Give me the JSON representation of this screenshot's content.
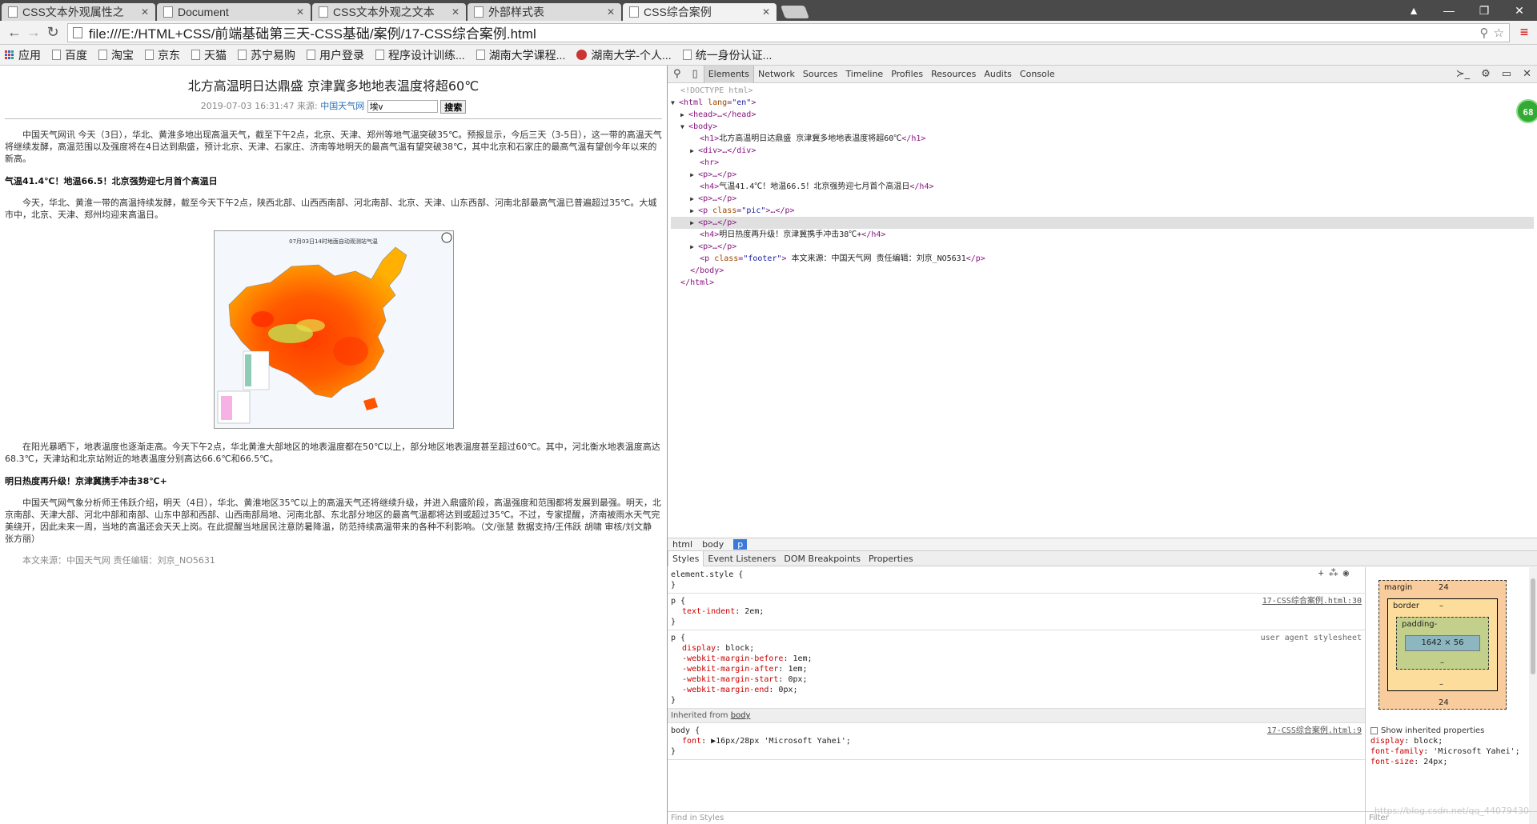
{
  "tabs": [
    {
      "title": "CSS文本外观属性之",
      "active": false
    },
    {
      "title": "Document",
      "active": false
    },
    {
      "title": "CSS文本外观之文本",
      "active": false
    },
    {
      "title": "外部样式表",
      "active": false
    },
    {
      "title": "CSS综合案例",
      "active": true
    }
  ],
  "address": {
    "url": "file:///E:/HTML+CSS/前端基础第三天-CSS基础/案例/17-CSS综合案例.html"
  },
  "bookmarks": [
    "应用",
    "百度",
    "淘宝",
    "京东",
    "天猫",
    "苏宁易购",
    "用户登录",
    "程序设计训练...",
    "湖南大学课程...",
    "湖南大学-个人...",
    "统一身份认证..."
  ],
  "article": {
    "title": "北方高温明日达鼎盛 京津冀多地地表温度将超60℃",
    "date_source": "2019-07-03 16:31:47 来源: ",
    "source_link": "中国天气网",
    "search_value": "埃v",
    "search_button": "搜索",
    "p1": "中国天气网讯 今天（3日），华北、黄淮多地出现高温天气，截至下午2点，北京、天津、郑州等地气温突破35℃。预报显示，今后三天（3-5日），这一带的高温天气将继续发酵，高温范围以及强度将在4日达到鼎盛，预计北京、天津、石家庄、济南等地明天的最高气温有望突破38℃，其中北京和石家庄的最高气温有望创今年以来的新高。",
    "h4_1": "气温41.4℃！地温66.5！北京强势迎七月首个高温日",
    "p2": "今天，华北、黄淮一带的高温持续发酵，截至今天下午2点，陕西北部、山西西南部、河北南部、北京、天津、山东西部、河南北部最高气温已普遍超过35℃。大城市中，北京、天津、郑州均迎来高温日。",
    "map_title": "07月03日14时地面自动观测站气温",
    "p3": "在阳光暴晒下，地表温度也逐渐走高。今天下午2点，华北黄淮大部地区的地表温度都在50℃以上，部分地区地表温度甚至超过60℃。其中，河北衡水地表温度高达68.3℃，天津站和北京站附近的地表温度分别高达66.6℃和66.5℃。",
    "h4_2": "明日热度再升级！京津冀携手冲击38℃+",
    "p4": "中国天气网气象分析师王伟跃介绍，明天（4日），华北、黄淮地区35℃以上的高温天气还将继续升级，并进入鼎盛阶段，高温强度和范围都将发展到最强。明天，北京南部、天津大部、河北中部和南部、山东中部和西部、山西南部局地、河南北部、东北部分地区的最高气温都将达到或超过35℃。不过，专家提醒，济南被雨水天气完美绕开，因此未来一周，当地的高温还会天天上岗。在此提醒当地居民注意防暑降温，防范持续高温带来的各种不利影响。（文/张慧 数据支持/王伟跃 胡啸 审核/刘文静 张方丽）",
    "footer": "本文来源：中国天气网 责任编辑：刘京_NO5631"
  },
  "devtools": {
    "tabs": [
      "Elements",
      "Network",
      "Sources",
      "Timeline",
      "Profiles",
      "Resources",
      "Audits",
      "Console"
    ],
    "active_tab": "Elements",
    "badge": "68",
    "dom": {
      "doctype": "<!DOCTYPE html>",
      "html_open": "<html ",
      "lang_attr": "lang",
      "lang_val": "\"en\"",
      "head": "<head>…</head>",
      "body_open": "<body>",
      "h1_text": "北方高温明日达鼎盛 京津冀多地地表温度将超60℃",
      "div": "<div>…</div>",
      "hr": "<hr>",
      "p_collapsed": "<p>…</p>",
      "h4_1_text": "气温41.4℃！地温66.5！北京强势迎七月首个高温日",
      "p_pic_class": "\"pic\"",
      "h4_2_text": "明日热度再升级！京津冀携手冲击38℃+",
      "footer_class": "\"footer\"",
      "footer_text": " 本文来源：中国天气网 责任编辑：刘京_NO5631",
      "body_close": "</body>",
      "html_close": "</html>"
    },
    "breadcrumbs": [
      "html",
      "body",
      "p"
    ],
    "subtabs": [
      "Styles",
      "Event Listeners",
      "DOM Breakpoints",
      "Properties"
    ],
    "styles": {
      "element_style": "element.style {",
      "rule1_selector": "p {",
      "rule1_source": "17-CSS综合案例.html:30",
      "rule1_prop": "text-indent",
      "rule1_val": "2em;",
      "rule2_selector": "p {",
      "rule2_source": "user agent stylesheet",
      "rule2_props": [
        {
          "n": "display",
          "v": "block;"
        },
        {
          "n": "-webkit-margin-before",
          "v": "1em;"
        },
        {
          "n": "-webkit-margin-after",
          "v": "1em;"
        },
        {
          "n": "-webkit-margin-start",
          "v": "0px;"
        },
        {
          "n": "-webkit-margin-end",
          "v": "0px;"
        }
      ],
      "inherited_prefix": "Inherited from ",
      "inherited_from": "body",
      "rule3_selector": "body {",
      "rule3_source": "17-CSS综合案例.html:9",
      "rule3_prop": "font",
      "rule3_val": "▶16px/28px 'Microsoft Yahei';",
      "close": "}",
      "find_placeholder": "Find in Styles"
    },
    "boxmodel": {
      "margin_label": "margin",
      "margin_top": "24",
      "margin_bottom": "24",
      "border_label": "border",
      "padding_label": "padding-",
      "dash": "–",
      "content": "1642 × 56"
    },
    "computed": {
      "show_inherited": "Show inherited properties",
      "l1n": "display",
      "l1v": "block;",
      "l2n": "font-family",
      "l2v": "'Microsoft Yahei';",
      "l3n": "font-size",
      "l3v": "24px;",
      "filter_placeholder": "Filter"
    }
  },
  "watermark": "https://blog.csdn.net/qq_44079430"
}
